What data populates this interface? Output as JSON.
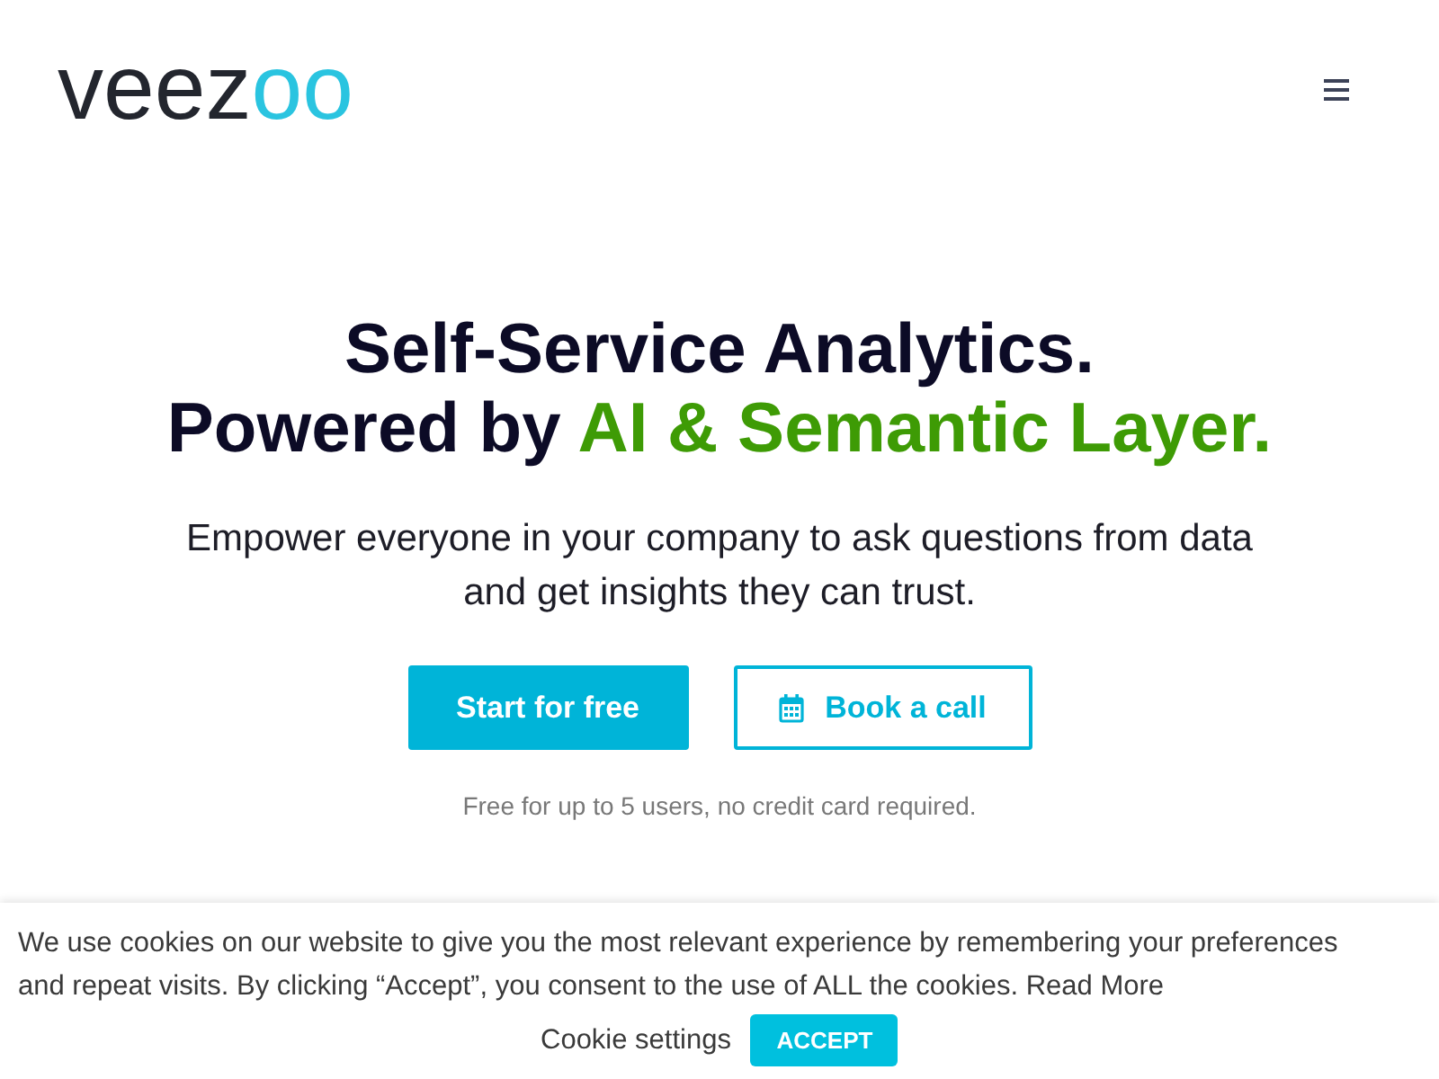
{
  "header": {
    "logo": {
      "text": "veez",
      "accent": "oo"
    }
  },
  "hero": {
    "headline": {
      "line_1": "Self-Service Analytics.",
      "line_2": "Powered by",
      "line_2_highlight": "AI & Semantic Layer."
    },
    "subtitle": "Empower everyone in your company to ask questions from data and get insights they can trust.",
    "buttons": [
      {
        "label": "Start for free",
        "kind": "primary"
      },
      {
        "label": "Book a call",
        "kind": "outline"
      }
    ],
    "note": "Free for up to 5 users, no credit card required."
  },
  "cookie_banner": {
    "message": "We use cookies on our website to give you the most relevant experience by remembering your preferences and repeat visits. By clicking “Accept”, you consent to the use of ALL the cookies.",
    "link": "Read More",
    "settings_link": "Cookie settings",
    "accept_button": "ACCEPT"
  }
}
